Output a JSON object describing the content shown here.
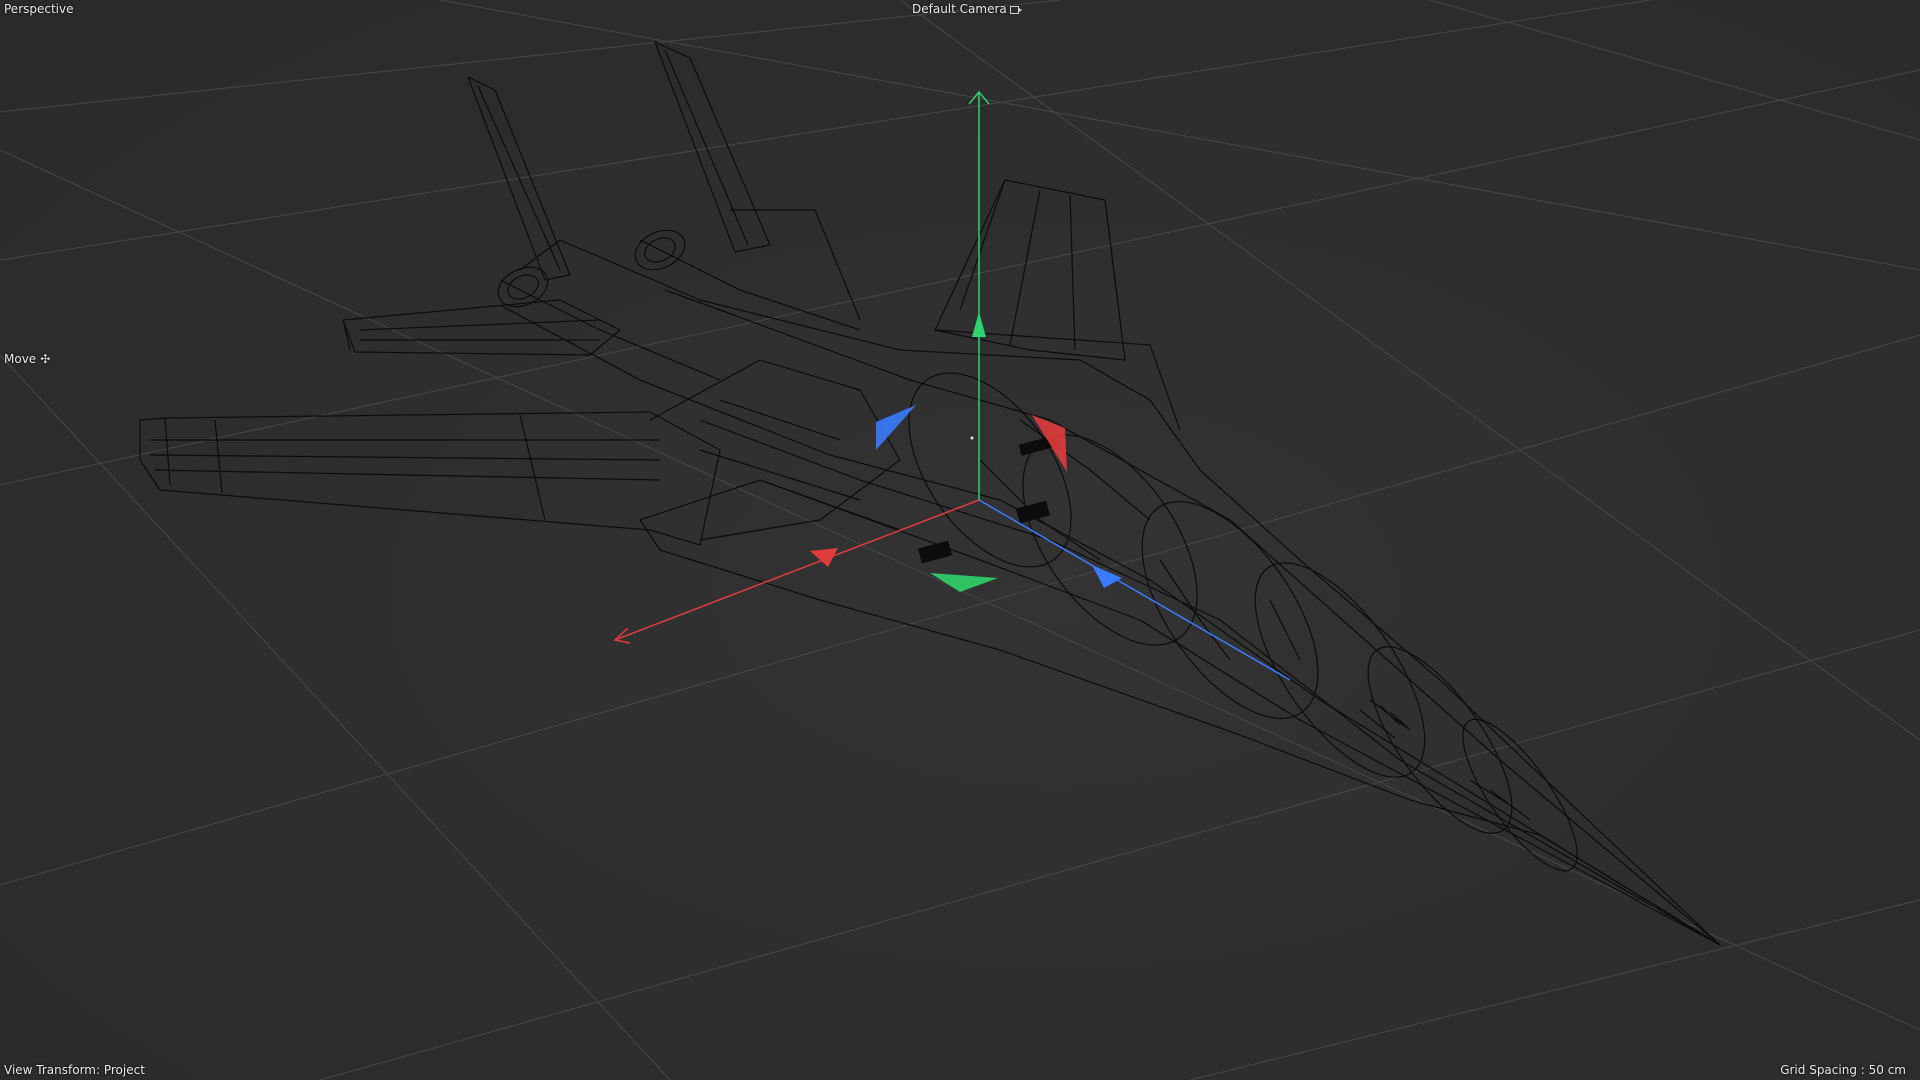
{
  "viewport": {
    "view_name": "Perspective",
    "camera_name": "Default Camera",
    "camera_icon": "camera-icon",
    "tool_name": "Move",
    "tool_icon": "move-icon",
    "view_transform": "View Transform: Project",
    "grid_spacing": "Grid Spacing : 50 cm"
  },
  "scene": {
    "object": "fighter-jet-wireframe",
    "display_mode": "wireframe",
    "gizmo": "move",
    "colors": {
      "background": "#2e2e2e",
      "grid": "#4a4a4a",
      "wire": "#0b0b0b",
      "axis_x": "#e03c3c",
      "axis_y": "#2fd36b",
      "axis_z": "#3a7bff"
    }
  }
}
